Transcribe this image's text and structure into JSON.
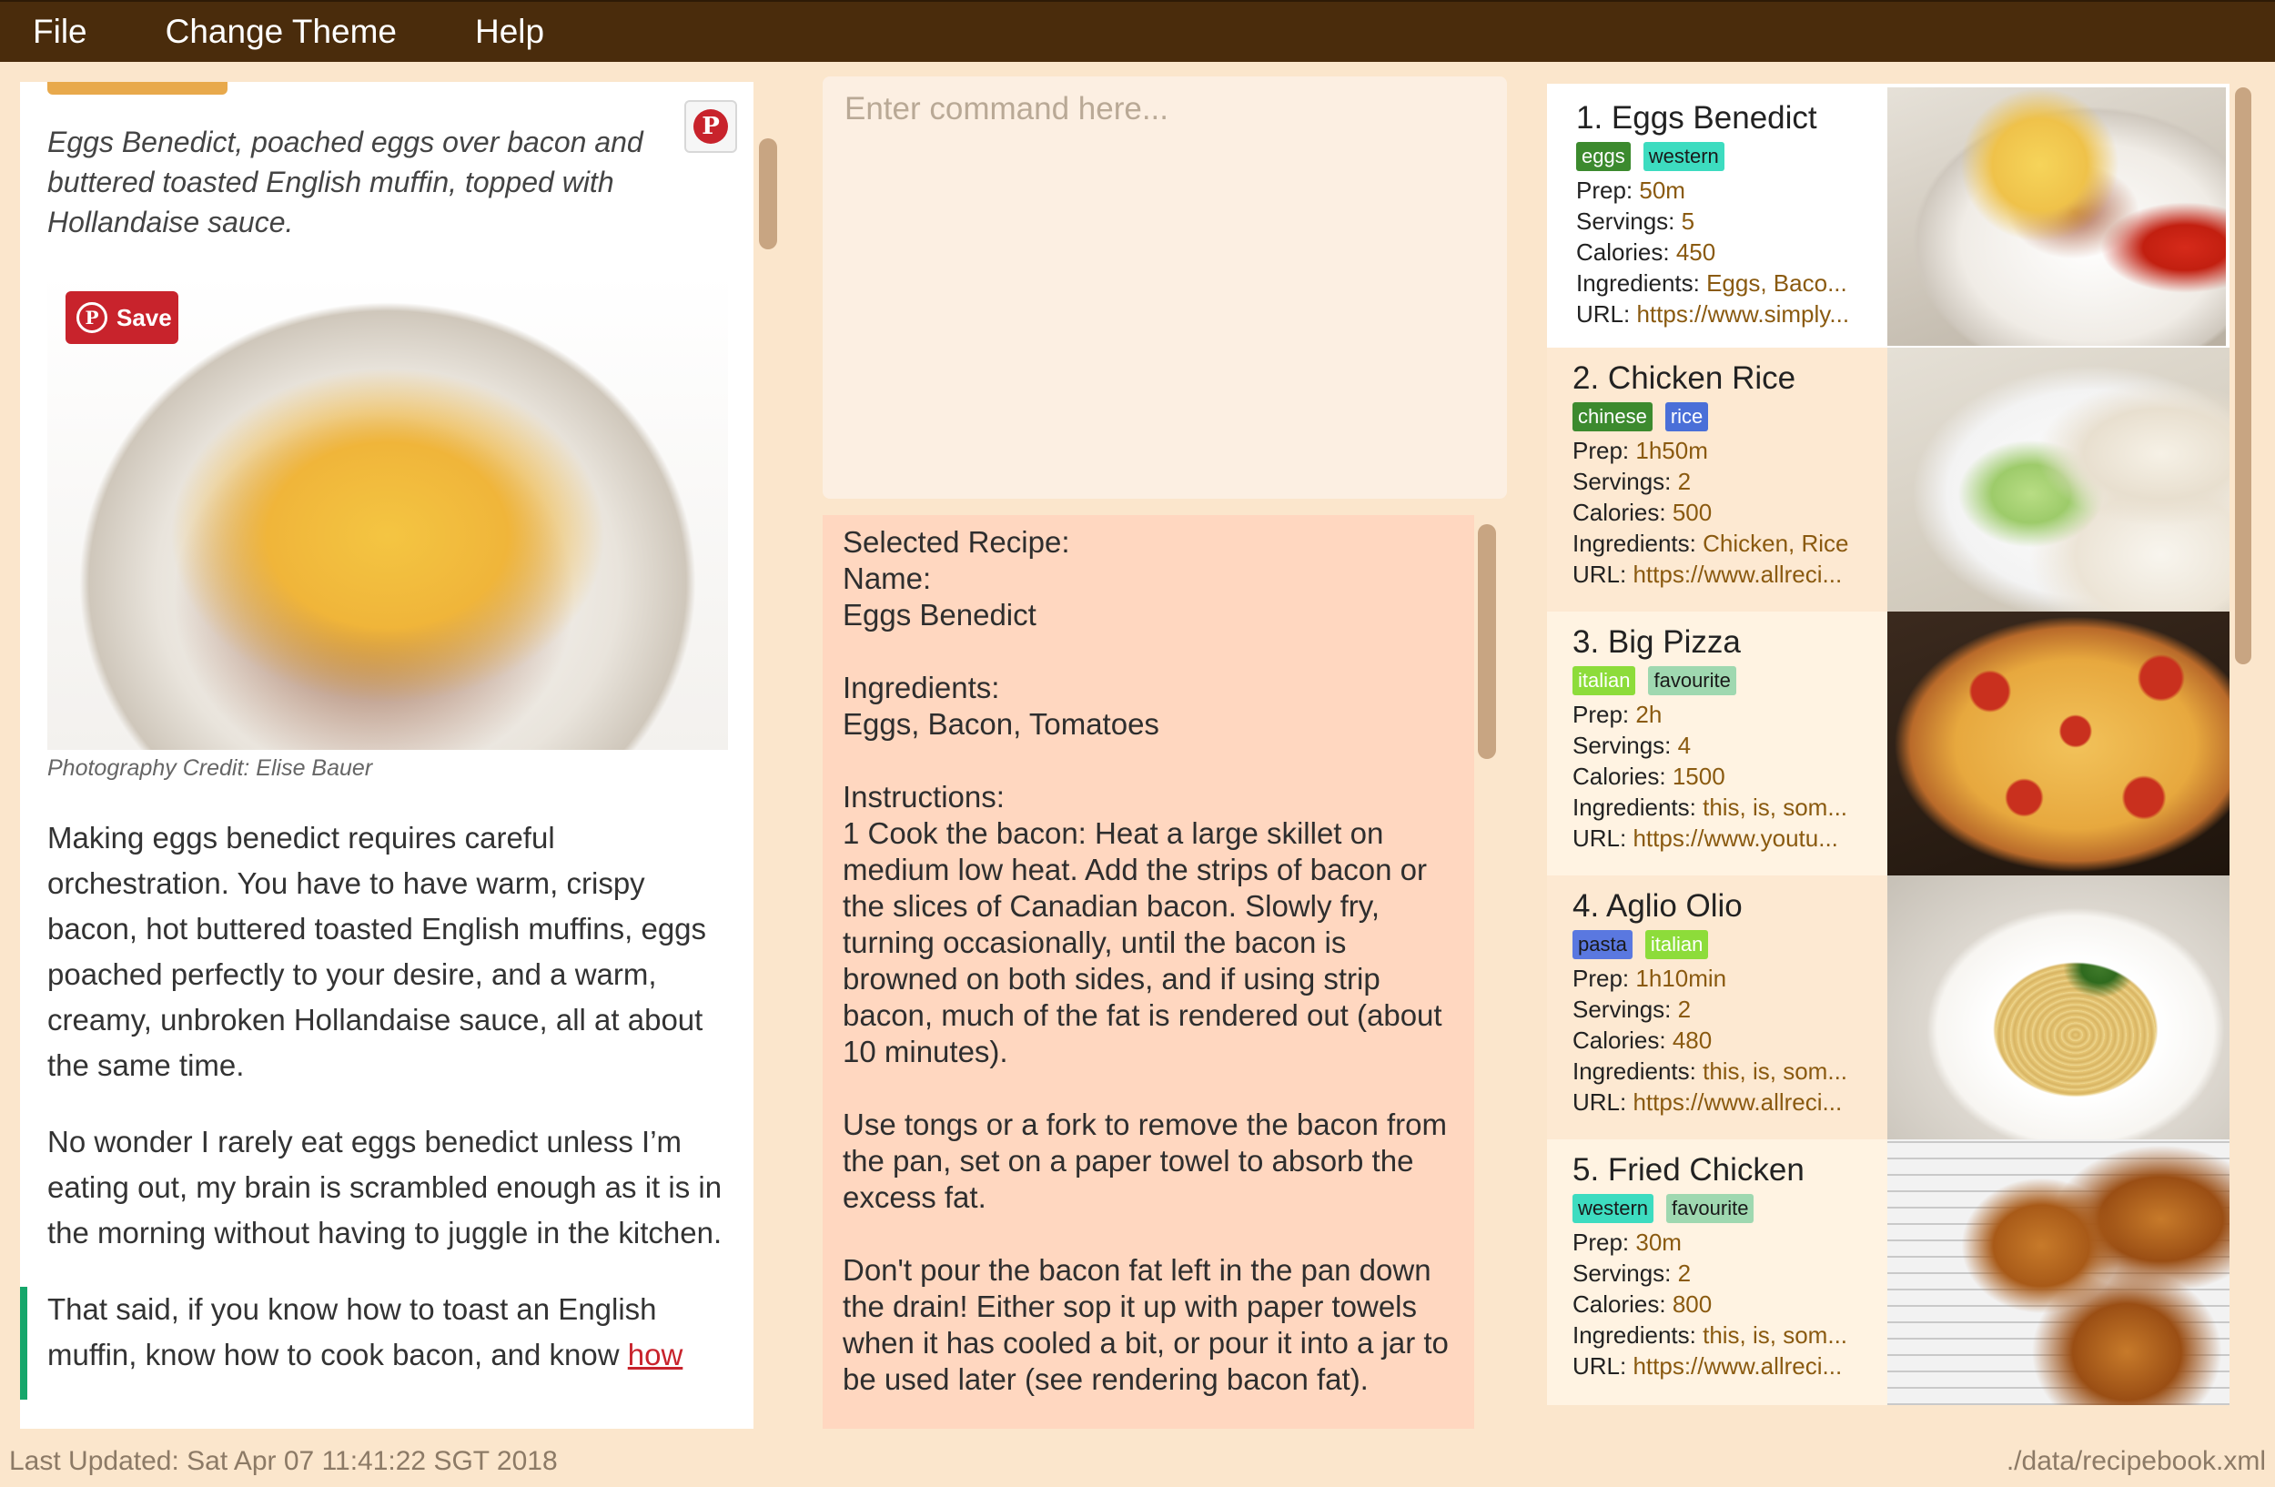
{
  "menu": {
    "items": [
      "File",
      "Change Theme",
      "Help"
    ]
  },
  "browser": {
    "caption": "Eggs Benedict, poached eggs over bacon and buttered toasted English muffin, topped with Hollandaise sauce.",
    "save_label": "Save",
    "photo_credit": "Photography Credit: Elise Bauer",
    "paragraph1": "Making eggs benedict requires careful orchestration. You have to have warm, crispy bacon, hot buttered toasted English muffins, eggs poached perfectly to your desire, and a warm, creamy, unbroken Hollandaise sauce, all at about the same time.",
    "paragraph2": "No wonder I rarely eat eggs benedict unless I’m eating out, my brain is scrambled enough as it is in the morning without having to juggle in the kitchen.",
    "paragraph3": "That said, if you know how to toast an English muffin, know how to cook bacon, and know ",
    "paragraph3_link": "how"
  },
  "command": {
    "placeholder": "Enter command here..."
  },
  "detail": {
    "text": "Selected Recipe:\nName:\nEggs Benedict\n\nIngredients:\nEggs, Bacon, Tomatoes\n\nInstructions:\n1 Cook the bacon: Heat a large skillet on medium low heat. Add the strips of bacon or the slices of Canadian bacon. Slowly fry, turning occasionally, until the bacon is browned on both sides, and if using strip bacon, much of the fat is rendered out (about 10 minutes).\n\nUse tongs or a fork to remove the bacon from the pan, set on a paper towel to absorb the excess fat.\n\nDon't pour the bacon fat left in the pan down the drain! Either sop it up with paper towels when it has cooled a bit, or pour it into a jar to be used later (see rendering bacon fat)."
  },
  "recipes": [
    {
      "title": "1.  Eggs Benedict",
      "tags": [
        {
          "label": "eggs",
          "bg": "#3c8a2e",
          "fg": "#ffffff"
        },
        {
          "label": "western",
          "bg": "#3ddcc0",
          "fg": "#1a1a1a"
        }
      ],
      "prep": "50m",
      "servings": "5",
      "calories": "450",
      "ingredients": "Eggs, Baco...",
      "url": "https://www.simply...",
      "thumb": "thumb-eggs"
    },
    {
      "title": "2.  Chicken Rice",
      "tags": [
        {
          "label": "chinese",
          "bg": "#3c8a2e",
          "fg": "#ffffff"
        },
        {
          "label": "rice",
          "bg": "#4a6fd8",
          "fg": "#ffffff"
        }
      ],
      "prep": "1h50m",
      "servings": "2",
      "calories": "500",
      "ingredients": "Chicken, Rice",
      "url": "https://www.allreci...",
      "thumb": "thumb-chicken"
    },
    {
      "title": "3.  Big Pizza",
      "tags": [
        {
          "label": "italian",
          "bg": "#8ddc3a",
          "fg": "#ffffff"
        },
        {
          "label": "favourite",
          "bg": "#9fd8b0",
          "fg": "#1a1a1a"
        }
      ],
      "prep": "2h",
      "servings": "4",
      "calories": "1500",
      "ingredients": "this, is, som...",
      "url": "https://www.youtu...",
      "thumb": "thumb-pizza"
    },
    {
      "title": "4.  Aglio Olio",
      "tags": [
        {
          "label": "pasta",
          "bg": "#5a78e0",
          "fg": "#1a1a1a"
        },
        {
          "label": "italian",
          "bg": "#8ddc3a",
          "fg": "#ffffff"
        }
      ],
      "prep": "1h10min",
      "servings": "2",
      "calories": "480",
      "ingredients": "this, is, som...",
      "url": "https://www.allreci...",
      "thumb": "thumb-pasta"
    },
    {
      "title": "5.  Fried Chicken",
      "tags": [
        {
          "label": "western",
          "bg": "#3ddcc0",
          "fg": "#1a1a1a"
        },
        {
          "label": "favourite",
          "bg": "#9fd8b0",
          "fg": "#1a1a1a"
        }
      ],
      "prep": "30m",
      "servings": "2",
      "calories": "800",
      "ingredients": "this, is, som...",
      "url": "https://www.allreci...",
      "thumb": "thumb-fried"
    }
  ],
  "field_labels": {
    "prep": "Prep: ",
    "servings": "Servings: ",
    "calories": "Calories: ",
    "ingredients": "Ingredients: ",
    "url": "URL: "
  },
  "status": {
    "last_updated": "Last Updated: Sat Apr 07 11:41:22 SGT 2018",
    "file_path": "./data/recipebook.xml"
  },
  "colors": {
    "menubar": "#4a2c0c",
    "background": "#fbe6cc",
    "detail_bg": "#ffd7c0",
    "pinterest_red": "#c8232c"
  }
}
